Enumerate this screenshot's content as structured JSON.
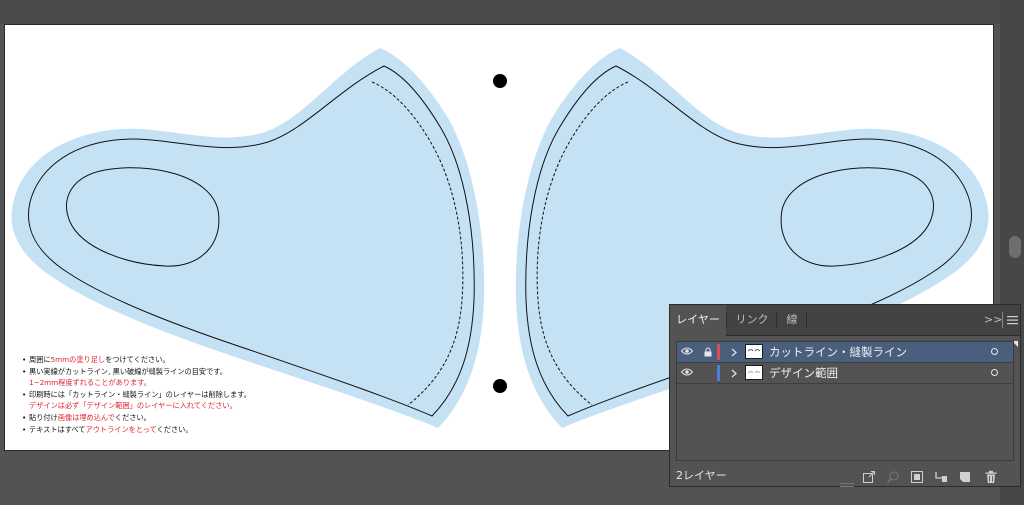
{
  "notes": [
    {
      "parts": [
        {
          "text": "周囲に",
          "red": false
        },
        {
          "text": "5mmの塗り足し",
          "red": true
        },
        {
          "text": "をつけてください。",
          "red": false
        }
      ],
      "bullet": true
    },
    {
      "parts": [
        {
          "text": "黒い実線がカットライン, 黒い破線が縫製ラインの目安です。",
          "red": false
        }
      ],
      "bullet": true
    },
    {
      "parts": [
        {
          "text": "1~2mm程度ずれることがあります。",
          "red": true
        }
      ],
      "bullet": false
    },
    {
      "parts": [
        {
          "text": "印刷時には「カットライン・縫製ライン」のレイヤーは削除します。",
          "red": false
        }
      ],
      "bullet": true
    },
    {
      "parts": [
        {
          "text": "デザインは必ず「デザイン範囲」のレイヤーに入れてください。",
          "red": true
        }
      ],
      "bullet": false
    },
    {
      "parts": [
        {
          "text": "貼り付け",
          "red": false
        },
        {
          "text": "画像は埋め込んで",
          "red": true
        },
        {
          "text": "ください。",
          "red": false
        }
      ],
      "bullet": true
    },
    {
      "parts": [
        {
          "text": "テキストはすべて",
          "red": false
        },
        {
          "text": "アウトラインをとって",
          "red": true
        },
        {
          "text": "ください。",
          "red": false
        }
      ],
      "bullet": true
    }
  ],
  "layers_panel": {
    "tabs": [
      {
        "label": "レイヤー",
        "active": true
      },
      {
        "label": "リンク",
        "active": false
      },
      {
        "label": "線",
        "active": false
      }
    ],
    "collapse_label": ">>",
    "menu_icon": "hamburger-menu-icon",
    "layers": [
      {
        "name": "カットライン・縫製ライン",
        "visible": true,
        "locked": true,
        "color": "#e04a56",
        "selected": true
      },
      {
        "name": "デザイン範囲",
        "visible": true,
        "locked": false,
        "color": "#4a7ee0",
        "selected": false
      }
    ],
    "footer_count": "2レイヤー",
    "footer_icons": [
      "export-icon",
      "locate-object-icon",
      "clipping-mask-icon",
      "new-sublayer-icon",
      "new-layer-icon",
      "delete-icon"
    ]
  },
  "colors": {
    "mask_fill": "#c5e2f5",
    "canvas_bg": "#535353",
    "selection": "#4a5f7d"
  }
}
